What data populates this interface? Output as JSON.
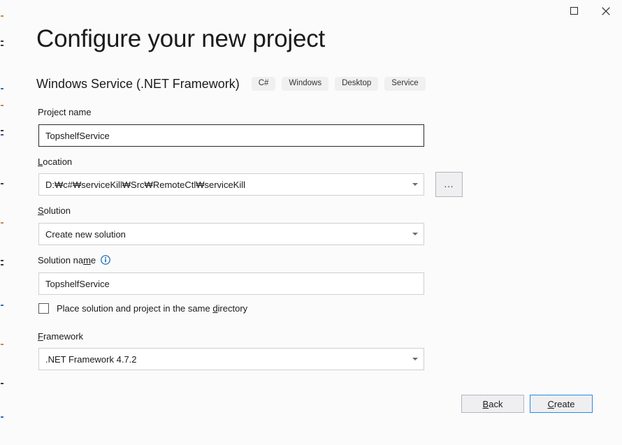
{
  "window": {
    "controls": [
      {
        "name": "maximize",
        "icon": "maximize-icon",
        "label": "Maximize"
      },
      {
        "name": "close",
        "icon": "close-icon",
        "label": "Close"
      }
    ]
  },
  "header": {
    "title": "Configure your new project",
    "template_name": "Windows Service (.NET Framework)",
    "tags": [
      "C#",
      "Windows",
      "Desktop",
      "Service"
    ]
  },
  "form": {
    "project_name": {
      "label": "Project name",
      "value": "TopshelfService",
      "placeholder": ""
    },
    "location": {
      "label_pre": "L",
      "label_key": "o",
      "label_post": "cation",
      "label": "Location",
      "value": "D:₩c#₩serviceKill₩Src₩RemoteCtl₩serviceKill",
      "browse_label": "..."
    },
    "solution": {
      "label_pre": "",
      "label_key": "S",
      "label_post": "olution",
      "label": "Solution",
      "value": "Create new solution"
    },
    "solution_name": {
      "label_pre": "Solution na",
      "label_key": "m",
      "label_post": "e",
      "label": "Solution name",
      "value": "TopshelfService",
      "info_icon": "info-icon"
    },
    "same_directory": {
      "label_pre": "Place solution and project in the same ",
      "label_key": "d",
      "label_post": "irectory",
      "label": "Place solution and project in the same directory",
      "checked": false
    },
    "framework": {
      "label_pre": "",
      "label_key": "F",
      "label_post": "ramework",
      "label": "Framework",
      "value": ".NET Framework 4.7.2"
    }
  },
  "footer": {
    "back": {
      "pre": "",
      "key": "B",
      "post": "ack",
      "label": "Back"
    },
    "create": {
      "pre": "",
      "key": "C",
      "post": "reate",
      "label": "Create"
    }
  },
  "colors": {
    "accent": "#2b8ae2",
    "info": "#0a65b0",
    "background": "#fbfbfb",
    "field_border": "#cfcfd6",
    "field_border_focused": "#2b2b2b"
  }
}
